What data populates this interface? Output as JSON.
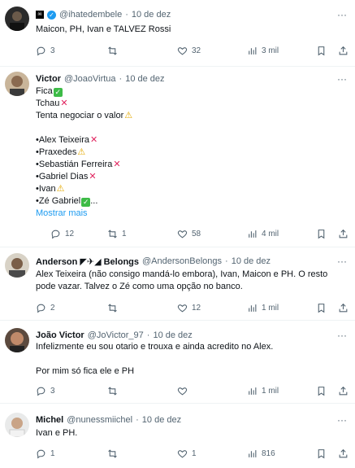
{
  "tweets": [
    {
      "handle": "@ihatedembele",
      "dot": "·",
      "date": "10 de dez",
      "lines": [
        "Maicon, PH, Ivan e TALVEZ Rossi"
      ],
      "replies": "3",
      "retweets": "",
      "likes": "32",
      "views": "3 mil"
    },
    {
      "name": "Victor",
      "handle": "@JoaoVirtua",
      "dot": "·",
      "date": "10 de dez",
      "lines": [
        "Fica",
        "Tchau",
        "Tenta negociar o valor",
        "",
        "•Alex Teixeira",
        "•Praxedes",
        "•Sebastián Ferreira",
        "•Gabriel Dias",
        "•Ivan",
        "•Zé Gabriel",
        "..."
      ],
      "show_more": "Mostrar mais",
      "replies": "12",
      "retweets": "1",
      "likes": "58",
      "views": "4 mil"
    },
    {
      "name": "Anderson",
      "name_suffix": "Belongs",
      "handle": "@AndersonBelongs",
      "dot": "·",
      "date": "10 de dez",
      "lines": [
        "Alex Teixeira (não consigo mandá-lo embora), Ivan, Maicon e PH. O resto",
        "pode vazar. Talvez o Zé como uma opção no banco."
      ],
      "replies": "2",
      "retweets": "",
      "likes": "12",
      "views": "1 mil"
    },
    {
      "name": "João Victor",
      "handle": "@JoVictor_97",
      "dot": "·",
      "date": "10 de dez",
      "lines": [
        "Infelizmente eu sou otario e trouxa e ainda acredito no Alex.",
        "",
        "Por mim só fica ele e PH"
      ],
      "replies": "3",
      "retweets": "",
      "likes": "",
      "views": "1 mil"
    },
    {
      "name": "Michel",
      "handle": "@nunessmiichel",
      "dot": "·",
      "date": "10 de dez",
      "lines": [
        "Ivan e PH."
      ],
      "replies": "1",
      "retweets": "",
      "likes": "1",
      "views": "816"
    }
  ],
  "colors": {
    "link": "#1d9bf0",
    "muted": "#536471",
    "text": "#0f1419",
    "check": "#3dbb47",
    "cross": "#e0245e",
    "warn": "#e3a800"
  }
}
